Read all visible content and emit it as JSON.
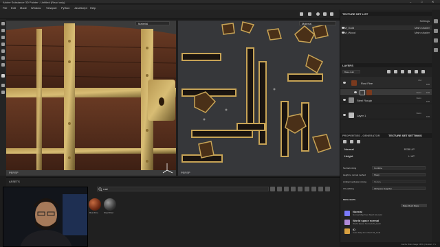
{
  "window": {
    "title": "Adobe Substance 3D Painter - Untitled (Read only)",
    "controls": [
      "–",
      "□",
      "✕"
    ]
  },
  "menu": [
    "File",
    "Edit",
    "Mode",
    "Window",
    "Viewport",
    "Python",
    "JavaScript",
    "Help"
  ],
  "viewport": {
    "left_mode": "Material",
    "right_mode": "Material",
    "left_label": "PERSP",
    "right_label": "PERSP"
  },
  "shelf": {
    "title": "ASSETS",
    "search_value": "rust",
    "materials": [
      {
        "label": "Rust Fine",
        "color": "#7a3a22"
      },
      {
        "label": "Steel Rust",
        "color": "#3a3a3a"
      }
    ]
  },
  "texture_set_list": {
    "title": "TEXTURE SET LIST",
    "settings_label": "Settings",
    "rows": [
      {
        "name": "M_Gold",
        "shader": "Main shader"
      },
      {
        "name": "M_Wood",
        "shader": "Main shader"
      }
    ]
  },
  "layers": {
    "title": "LAYERS",
    "base_color": "Base color",
    "rows": [
      {
        "name": "Rust Fine",
        "blend": "Pt2",
        "opacity": "100",
        "color": "#7a3a1e"
      },
      {
        "name": "",
        "blend": "Norm",
        "opacity": "100",
        "color": "#3a3a3a"
      },
      {
        "name": "Steel Rough",
        "blend": "Norm",
        "opacity": "100",
        "color": "#8a8a8a"
      },
      {
        "name": "Layer 1",
        "blend": "Norm",
        "opacity": "100",
        "color": "#bdbdbd"
      }
    ]
  },
  "properties": {
    "tab_generator": "PROPERTIES - GENERATOR",
    "tab_tex": "TEXTURE SET SETTINGS",
    "normal_label": "Normal",
    "normal_val": "RGB UP",
    "height_label": "Height",
    "height_val": "L UP",
    "fields": [
      {
        "label": "Normal mixing",
        "value": "Combine"
      },
      {
        "label": "Height to normal method",
        "value": "Sharp"
      },
      {
        "label": "Ambient occlusion mixing",
        "value": "Multiply"
      },
      {
        "label": "UV padding",
        "value": "3D Space Neighbor"
      }
    ],
    "mesh_maps_title": "MESH MAPS",
    "bake_button": "Bake Mesh Maps",
    "mesh_maps": [
      {
        "title": "Normal",
        "sub": "Normal Map from Mesh M_Gold",
        "color": "#7a7aff"
      },
      {
        "title": "World space normal",
        "sub": "World Space Normals M_Gold",
        "color": "#b08ad8"
      },
      {
        "title": "ID",
        "sub": "Color Map from Mesh M_Gold",
        "color": "#d8a040"
      }
    ]
  },
  "status": "Cache Disk Usage: 36% | Version: 7.x"
}
